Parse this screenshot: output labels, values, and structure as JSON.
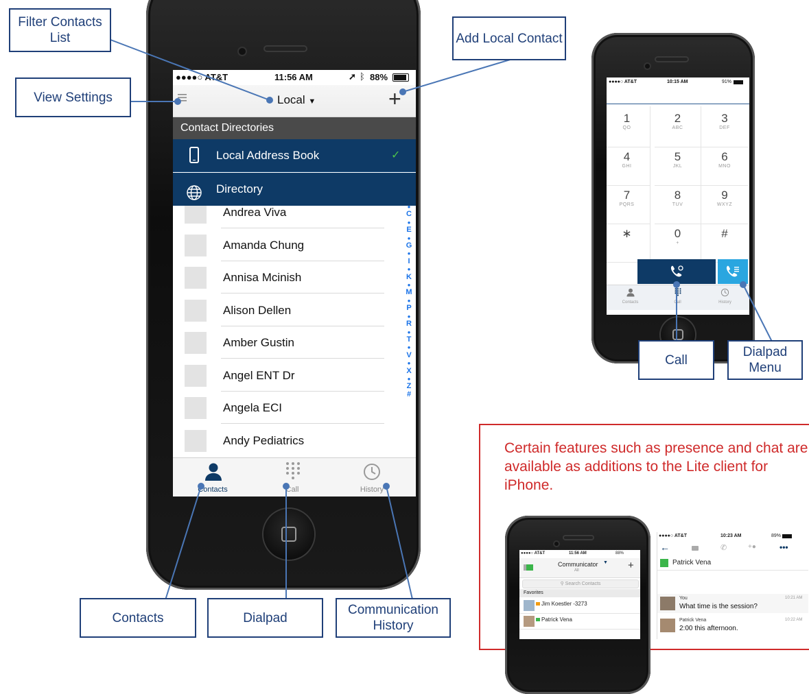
{
  "callouts": {
    "filter": "Filter Contacts List",
    "add_local": "Add Local Contact",
    "view_settings": "View Settings",
    "contacts": "Contacts",
    "dialpad": "Dialpad",
    "history": "Communication History",
    "call": "Call",
    "dialpad_menu": "Dialpad Menu"
  },
  "main_phone": {
    "status": {
      "carrier": "●●●●○ AT&T",
      "time": "11:56 AM",
      "battery": "88%"
    },
    "nav_title": "Local",
    "add_icon": "+",
    "dir_header": "Contact Directories",
    "directories": [
      {
        "label": "Local Address Book",
        "icon": "phone-icon",
        "checked": true
      },
      {
        "label": "Directory",
        "icon": "globe-icon",
        "checked": false
      }
    ],
    "contacts": [
      "Andrea Viva",
      "Amanda Chung",
      "Annisa Mcinish",
      "Alison Dellen",
      "Amber Gustin",
      "Angel ENT Dr",
      "Angela ECI",
      "Andy Pediatrics"
    ],
    "index_letters": [
      "●",
      "C",
      "●",
      "E",
      "●",
      "G",
      "●",
      "I",
      "●",
      "K",
      "●",
      "M",
      "●",
      "P",
      "●",
      "R",
      "●",
      "T",
      "●",
      "V",
      "●",
      "X",
      "●",
      "Z",
      "#"
    ],
    "tabs": [
      "Contacts",
      "Call",
      "History"
    ]
  },
  "dial_phone": {
    "status": {
      "carrier": "●●●●○ AT&T",
      "time": "10:15 AM",
      "battery": "91%"
    },
    "keys": [
      {
        "d": "1",
        "l": "QO"
      },
      {
        "d": "2",
        "l": "ABC"
      },
      {
        "d": "3",
        "l": "DEF"
      },
      {
        "d": "4",
        "l": "GHI"
      },
      {
        "d": "5",
        "l": "JKL"
      },
      {
        "d": "6",
        "l": "MNO"
      },
      {
        "d": "7",
        "l": "PQRS"
      },
      {
        "d": "8",
        "l": "TUV"
      },
      {
        "d": "9",
        "l": "WXYZ"
      },
      {
        "d": "∗",
        "l": ""
      },
      {
        "d": "0",
        "l": "+"
      },
      {
        "d": "#",
        "l": ""
      }
    ],
    "tabs": [
      "Contacts",
      "Call",
      "History"
    ]
  },
  "note": "Certain features such as presence and chat are available as additions to the Lite client for iPhone.",
  "mini_phone": {
    "status": {
      "carrier": "●●●●○ AT&T",
      "time": "11:56 AM",
      "battery": "88%"
    },
    "title": "Communicator",
    "subtitle": "All",
    "search_placeholder": "Search Contacts",
    "section": "Favorites",
    "contacts": [
      "Jim Koestler -3273",
      "Patrick Vena"
    ]
  },
  "chat": {
    "status": {
      "carrier": "●●●●○ AT&T",
      "time": "10:23 AM",
      "battery": "89%"
    },
    "contact": "Patrick Vena",
    "messages": [
      {
        "from": "You",
        "time": "10:21 AM",
        "text": "What time is the session?"
      },
      {
        "from": "Patrick Vena",
        "time": "10:22 AM",
        "text": "2:00 this afternoon."
      }
    ]
  }
}
